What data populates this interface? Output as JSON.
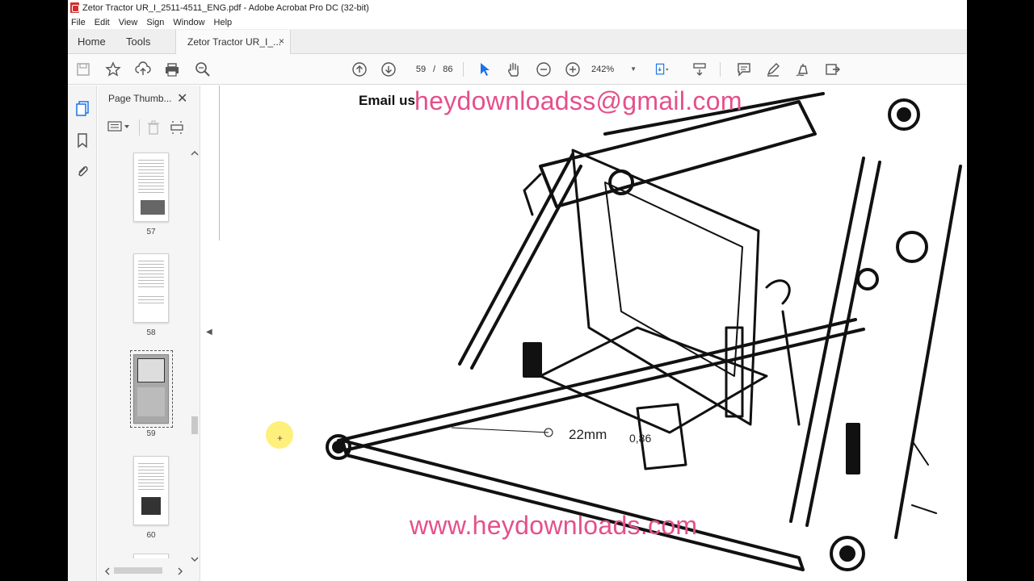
{
  "window": {
    "title": "Zetor Tractor UR_I_2511-4511_ENG.pdf - Adobe Acrobat Pro DC (32-bit)"
  },
  "menu": [
    "File",
    "Edit",
    "View",
    "Sign",
    "Window",
    "Help"
  ],
  "tabs": {
    "home": "Home",
    "tools": "Tools",
    "document": "Zetor Tractor UR_I_...",
    "document_close": "×"
  },
  "toolbar": {
    "current_page": "59",
    "page_separator": "/",
    "total_pages": "86",
    "zoom": "242%"
  },
  "thumbnails_panel": {
    "title": "Page Thumb...",
    "close": "✕",
    "pages": [
      "57",
      "58",
      "59",
      "60"
    ],
    "selected_page": "59"
  },
  "document": {
    "email_label": "Email us:",
    "email_value": "heydownloadss@gmail.com",
    "website": "www.heydownloads.com",
    "drawing_label": "22mm",
    "drawing_sub": "0,86"
  },
  "colors": {
    "watermark": "#e4508a",
    "acrobat_red": "#d32f2f",
    "select_tool_blue": "#1a73e8"
  }
}
